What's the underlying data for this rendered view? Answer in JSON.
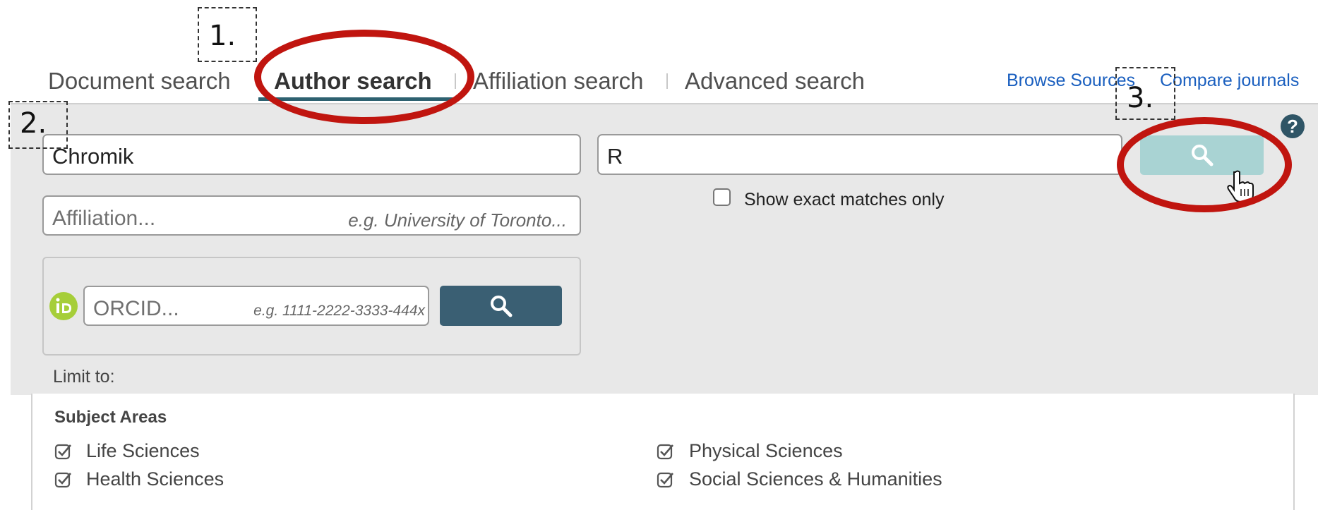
{
  "tabs": [
    {
      "label": "Document search",
      "active": false
    },
    {
      "label": "Author search",
      "active": true
    },
    {
      "label": "Affiliation search",
      "active": false
    },
    {
      "label": "Advanced search",
      "active": false
    }
  ],
  "top_links": {
    "browse_sources": "Browse Sources",
    "compare_journals": "Compare journals"
  },
  "form": {
    "last_name_value": "Chromik",
    "first_name_value": "R",
    "affiliation_placeholder": "Affiliation...",
    "affiliation_hint": "e.g. University of Toronto...",
    "orcid_placeholder": "ORCID...",
    "orcid_hint": "e.g. 1111-2222-3333-444x",
    "exact_matches_label": "Show exact matches only",
    "limit_to_label": "Limit to:",
    "help_symbol": "?"
  },
  "subject_areas": {
    "title": "Subject Areas",
    "items": [
      {
        "label": "Life Sciences",
        "checked": true
      },
      {
        "label": "Health Sciences",
        "checked": true
      },
      {
        "label": "Physical Sciences",
        "checked": true
      },
      {
        "label": "Social Sciences & Humanities",
        "checked": true
      }
    ]
  },
  "annotations": {
    "step1": "1.",
    "step2": "2.",
    "step3": "3."
  },
  "colors": {
    "tab_underline": "#2e6170",
    "orcid_button": "#3a5f73",
    "author_search_button": "#a9d3d3",
    "orcid_logo": "#a6ce39",
    "annotation_ring": "#c0150f",
    "link": "#1a5fbf"
  }
}
